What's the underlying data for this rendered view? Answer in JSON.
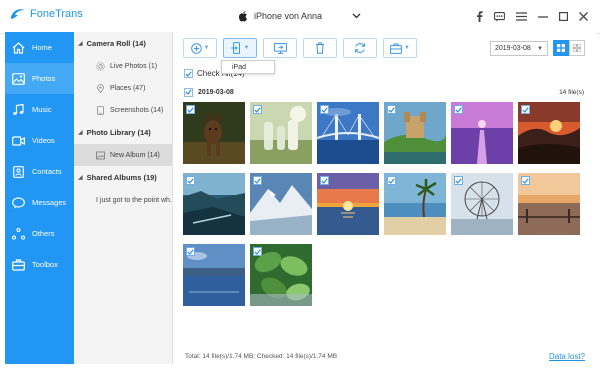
{
  "app": {
    "name": "FoneTrans",
    "device": "iPhone von Anna"
  },
  "sidebar": {
    "items": [
      {
        "label": "Home",
        "icon": "home-icon"
      },
      {
        "label": "Photos",
        "icon": "photos-icon"
      },
      {
        "label": "Music",
        "icon": "music-icon"
      },
      {
        "label": "Videos",
        "icon": "videos-icon"
      },
      {
        "label": "Contacts",
        "icon": "contacts-icon"
      },
      {
        "label": "Messages",
        "icon": "messages-icon"
      },
      {
        "label": "Others",
        "icon": "others-icon"
      },
      {
        "label": "Toolbox",
        "icon": "toolbox-icon"
      }
    ],
    "active": "Photos"
  },
  "tree": {
    "camera_roll": "Camera Roll (14)",
    "live_photos": "Live Photos (1)",
    "places": "Places (47)",
    "screenshots": "Screenshots (14)",
    "photo_library": "Photo Library (14)",
    "new_album": "New Album (14)",
    "shared_albums": "Shared Albums (19)",
    "shared_item": "I just got to the point wh."
  },
  "toolbar": {
    "dropdown_item": "iPad",
    "date_filter": "2019-03-08",
    "check_all": "Check All(14)"
  },
  "group": {
    "date": "2019-03-08",
    "count": "14 file(s)"
  },
  "photos": [
    {
      "scene": "dog",
      "checked": true
    },
    {
      "scene": "bottles",
      "checked": true
    },
    {
      "scene": "bridge",
      "checked": true
    },
    {
      "scene": "castle",
      "checked": true
    },
    {
      "scene": "pier",
      "checked": true
    },
    {
      "scene": "sunset-valley",
      "checked": true
    },
    {
      "scene": "cliffs",
      "checked": true
    },
    {
      "scene": "snow-mountain",
      "checked": true
    },
    {
      "scene": "sunset-sea",
      "checked": true
    },
    {
      "scene": "palm-beach",
      "checked": true
    },
    {
      "scene": "ferris-wheel",
      "checked": true
    },
    {
      "scene": "dock-sunset",
      "checked": true
    },
    {
      "scene": "lake",
      "checked": true
    },
    {
      "scene": "leaves",
      "checked": true
    }
  ],
  "status": {
    "text": "Total: 14 file(s)/1.74 MB; Checked: 14 file(s)/1.74 MB",
    "data_lost": "Data lost?"
  },
  "colors": {
    "accent": "#2196f3",
    "sidebar_active": "#43a9f7",
    "link": "#1f95e8"
  }
}
